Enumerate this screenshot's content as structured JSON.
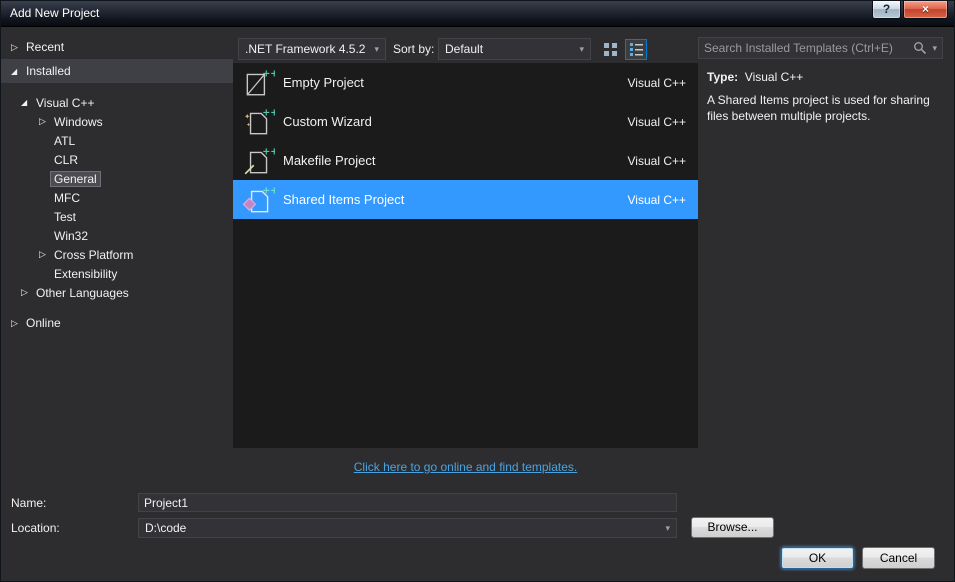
{
  "titlebar": {
    "title": "Add New Project",
    "help_icon": "?",
    "close_icon": "×"
  },
  "icons": {
    "collapsed": "▷",
    "expanded": "◢",
    "dropdown": "▾"
  },
  "colors": {
    "selection": "#3399ff",
    "link": "#4aa3e0",
    "tree_band": "#3f3f46"
  },
  "sidebar": {
    "items": [
      {
        "label": "Recent"
      },
      {
        "label": "Installed"
      },
      {
        "label": "Visual C++"
      },
      {
        "label": "Windows"
      },
      {
        "label": "ATL"
      },
      {
        "label": "CLR"
      },
      {
        "label": "General"
      },
      {
        "label": "MFC"
      },
      {
        "label": "Test"
      },
      {
        "label": "Win32"
      },
      {
        "label": "Cross Platform"
      },
      {
        "label": "Extensibility"
      },
      {
        "label": "Other Languages"
      },
      {
        "label": "Online"
      }
    ]
  },
  "toolbar": {
    "framework_dropdown": ".NET Framework 4.5.2",
    "sort_label": "Sort by:",
    "sort_dropdown": "Default",
    "search_placeholder": "Search Installed Templates (Ctrl+E)"
  },
  "templates": [
    {
      "name": "Empty Project",
      "language": "Visual C++"
    },
    {
      "name": "Custom Wizard",
      "language": "Visual C++"
    },
    {
      "name": "Makefile Project",
      "language": "Visual C++"
    },
    {
      "name": "Shared Items Project",
      "language": "Visual C++"
    }
  ],
  "info_panel": {
    "type_label": "Type:",
    "type_value": "Visual C++",
    "description": "A Shared Items project is used for sharing files between multiple projects."
  },
  "online_link": "Click here to go online and find templates.",
  "form": {
    "name_label": "Name:",
    "name_value": "Project1",
    "location_label": "Location:",
    "location_value": "D:\\code",
    "browse_button": "Browse...",
    "ok_button": "OK",
    "cancel_button": "Cancel"
  }
}
